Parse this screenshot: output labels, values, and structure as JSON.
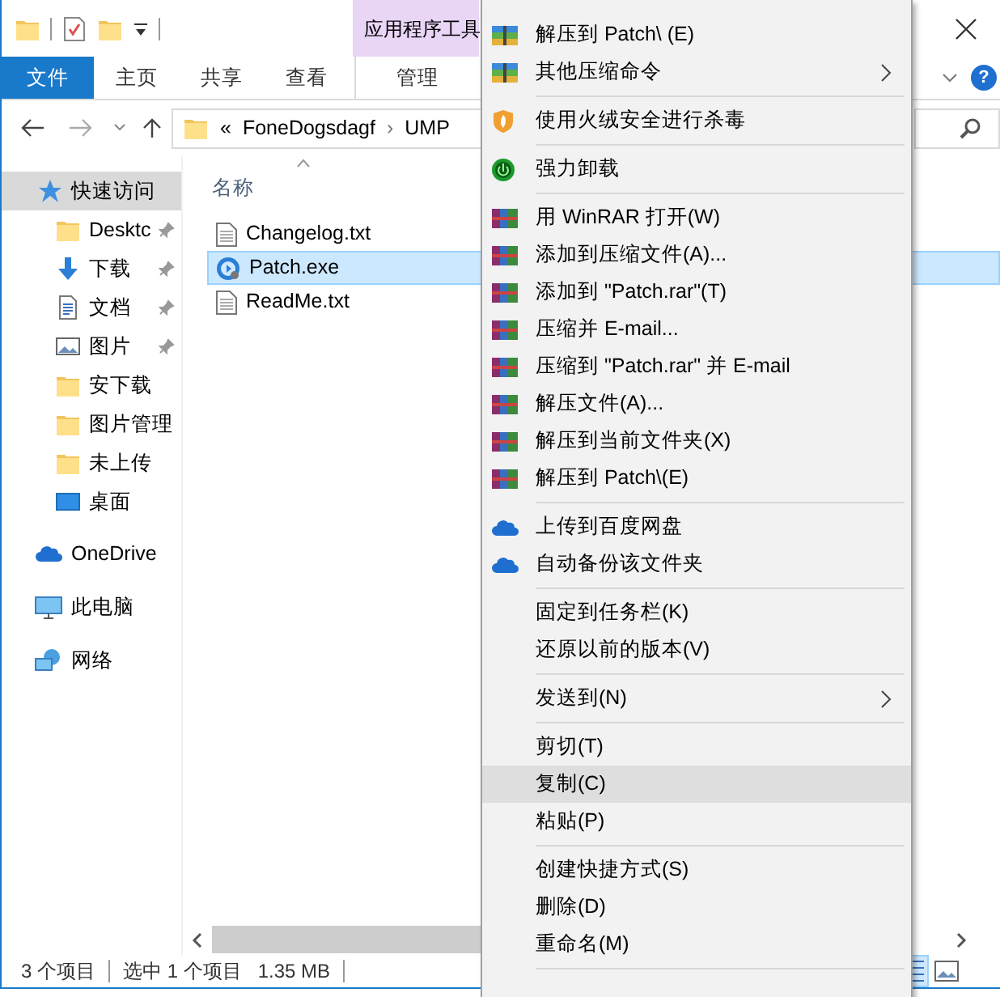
{
  "title_bar": {
    "contextual_group": "应用程序工具"
  },
  "ribbon": {
    "tabs": [
      {
        "label": "文件",
        "kind": "file",
        "selected": false
      },
      {
        "label": "主页",
        "kind": "normal",
        "selected": false
      },
      {
        "label": "共享",
        "kind": "normal",
        "selected": false
      },
      {
        "label": "查看",
        "kind": "normal",
        "selected": false
      },
      {
        "label": "管理",
        "kind": "contextual",
        "selected": false
      }
    ],
    "help": "?"
  },
  "address": {
    "overflow": "«",
    "parts": [
      "FoneDogsdagf",
      "UMP"
    ],
    "separator": "›"
  },
  "nav": [
    {
      "label": "快速访问",
      "kind": "star",
      "selected": true,
      "children": [
        {
          "label": "Desktc",
          "kind": "folder",
          "pinned": true,
          "selected": false
        },
        {
          "label": "下载",
          "kind": "download",
          "pinned": true,
          "selected": false
        },
        {
          "label": "文档",
          "kind": "document",
          "pinned": true,
          "selected": false
        },
        {
          "label": "图片",
          "kind": "picture",
          "pinned": true,
          "selected": false
        },
        {
          "label": "安下载",
          "kind": "folder",
          "pinned": false,
          "selected": false
        },
        {
          "label": "图片管理",
          "kind": "folder",
          "pinned": false,
          "selected": false
        },
        {
          "label": "未上传",
          "kind": "folder",
          "pinned": false,
          "selected": false
        },
        {
          "label": "桌面",
          "kind": "desktop",
          "pinned": false,
          "selected": false
        }
      ]
    },
    {
      "label": "OneDrive",
      "kind": "cloud",
      "selected": false
    },
    {
      "label": "此电脑",
      "kind": "pc",
      "selected": false
    },
    {
      "label": "网络",
      "kind": "network",
      "selected": false
    }
  ],
  "file_list": {
    "columns": [
      "名称"
    ],
    "rows": [
      {
        "name": "Changelog.txt",
        "kind": "text",
        "selected": false
      },
      {
        "name": "Patch.exe",
        "kind": "app",
        "selected": true
      },
      {
        "name": "ReadMe.txt",
        "kind": "text",
        "selected": false
      }
    ]
  },
  "status_bar": {
    "count": "3 个项目",
    "selection": "选中 1 个项目",
    "size": "1.35 MB",
    "views": [
      {
        "kind": "details",
        "selected": true
      },
      {
        "kind": "large-icons",
        "selected": false
      }
    ]
  },
  "context_menu": [
    {
      "kind": "archive",
      "label": "解压到 Patch\\ (E)",
      "submenu": false,
      "selected": false
    },
    {
      "kind": "archive",
      "label": "其他压缩命令",
      "submenu": true,
      "selected": false
    },
    {
      "kind": "separator"
    },
    {
      "kind": "shield",
      "label": "使用火绒安全进行杀毒",
      "submenu": false,
      "selected": false
    },
    {
      "kind": "separator"
    },
    {
      "kind": "power",
      "label": "强力卸载",
      "submenu": false,
      "selected": false
    },
    {
      "kind": "separator"
    },
    {
      "kind": "books",
      "label": "用 WinRAR 打开(W)",
      "submenu": false,
      "selected": false
    },
    {
      "kind": "books",
      "label": "添加到压缩文件(A)...",
      "submenu": false,
      "selected": false
    },
    {
      "kind": "books",
      "label": "添加到 \"Patch.rar\"(T)",
      "submenu": false,
      "selected": false
    },
    {
      "kind": "books",
      "label": "压缩并 E-mail...",
      "submenu": false,
      "selected": false
    },
    {
      "kind": "books",
      "label": "压缩到 \"Patch.rar\" 并 E-mail",
      "submenu": false,
      "selected": false
    },
    {
      "kind": "books",
      "label": "解压文件(A)...",
      "submenu": false,
      "selected": false
    },
    {
      "kind": "books",
      "label": "解压到当前文件夹(X)",
      "submenu": false,
      "selected": false
    },
    {
      "kind": "books",
      "label": "解压到 Patch\\(E)",
      "submenu": false,
      "selected": false
    },
    {
      "kind": "separator"
    },
    {
      "kind": "cloud",
      "label": "上传到百度网盘",
      "submenu": false,
      "selected": false
    },
    {
      "kind": "cloud",
      "label": "自动备份该文件夹",
      "submenu": false,
      "selected": false
    },
    {
      "kind": "separator"
    },
    {
      "kind": "plain",
      "label": "固定到任务栏(K)",
      "submenu": false,
      "selected": false
    },
    {
      "kind": "plain",
      "label": "还原以前的版本(V)",
      "submenu": false,
      "selected": false
    },
    {
      "kind": "separator"
    },
    {
      "kind": "plain",
      "label": "发送到(N)",
      "submenu": true,
      "selected": false
    },
    {
      "kind": "separator"
    },
    {
      "kind": "plain",
      "label": "剪切(T)",
      "submenu": false,
      "selected": false
    },
    {
      "kind": "plain",
      "label": "复制(C)",
      "submenu": false,
      "selected": true
    },
    {
      "kind": "plain",
      "label": "粘贴(P)",
      "submenu": false,
      "selected": false
    },
    {
      "kind": "separator"
    },
    {
      "kind": "plain",
      "label": "创建快捷方式(S)",
      "submenu": false,
      "selected": false
    },
    {
      "kind": "plain",
      "label": "删除(D)",
      "submenu": false,
      "selected": false
    },
    {
      "kind": "plain",
      "label": "重命名(M)",
      "submenu": false,
      "selected": false
    },
    {
      "kind": "separator"
    }
  ]
}
